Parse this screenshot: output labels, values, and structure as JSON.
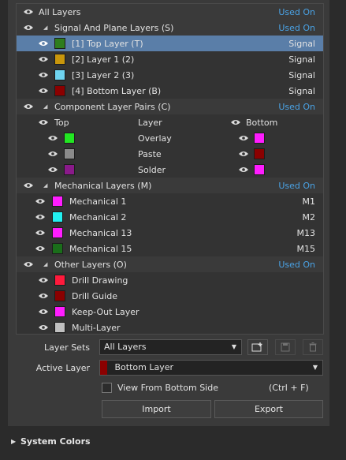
{
  "tree": {
    "all_layers": {
      "label": "All Layers",
      "status": "Used On"
    },
    "signal_group": {
      "label": "Signal And Plane Layers (S)",
      "status": "Used On"
    },
    "signal_layers": [
      {
        "label": "[1] Top Layer (T)",
        "type": "Signal",
        "color": "#2e7d1f"
      },
      {
        "label": "[2] Layer 1 (2)",
        "type": "Signal",
        "color": "#c8960c"
      },
      {
        "label": "[3] Layer 2 (3)",
        "type": "Signal",
        "color": "#6fd3ef"
      },
      {
        "label": "[4] Bottom Layer (B)",
        "type": "Signal",
        "color": "#8b0000"
      }
    ],
    "component_group": {
      "label": "Component Layer Pairs (C)",
      "status": "Used On"
    },
    "pair_header": {
      "top": "Top",
      "layer": "Layer",
      "bottom": "Bottom"
    },
    "pairs": [
      {
        "layer": "Overlay",
        "top_color": "#22e622",
        "bottom_color": "#ff1dff"
      },
      {
        "layer": "Paste",
        "top_color": "#8a8a8a",
        "bottom_color": "#8b0000"
      },
      {
        "layer": "Solder",
        "top_color": "#8a1a8a",
        "bottom_color": "#ff1dff"
      }
    ],
    "mechanical_group": {
      "label": "Mechanical Layers (M)",
      "status": "Used On"
    },
    "mechanical_layers": [
      {
        "label": "Mechanical 1",
        "code": "M1",
        "color": "#ff1dff"
      },
      {
        "label": "Mechanical 2",
        "code": "M2",
        "color": "#22f0f0"
      },
      {
        "label": "Mechanical 13",
        "code": "M13",
        "color": "#ff1dff"
      },
      {
        "label": "Mechanical 15",
        "code": "M15",
        "color": "#1a6e1a"
      }
    ],
    "other_group": {
      "label": "Other Layers (O)",
      "status": "Used On"
    },
    "other_layers": [
      {
        "label": "Drill Drawing",
        "color": "#ff1a3c"
      },
      {
        "label": "Drill Guide",
        "color": "#8b0000"
      },
      {
        "label": "Keep-Out Layer",
        "color": "#ff1dff"
      },
      {
        "label": "Multi-Layer",
        "color": "#c0c0c0"
      }
    ]
  },
  "form": {
    "layer_sets_label": "Layer Sets",
    "layer_sets_value": "All Layers",
    "active_layer_label": "Active Layer",
    "active_layer_value": "Bottom Layer",
    "active_layer_color": "#8b0000",
    "view_from_bottom_label": "View From Bottom Side",
    "view_from_bottom_shortcut": "(Ctrl + F)",
    "import_label": "Import",
    "export_label": "Export"
  },
  "system_colors": {
    "label": "System Colors"
  }
}
